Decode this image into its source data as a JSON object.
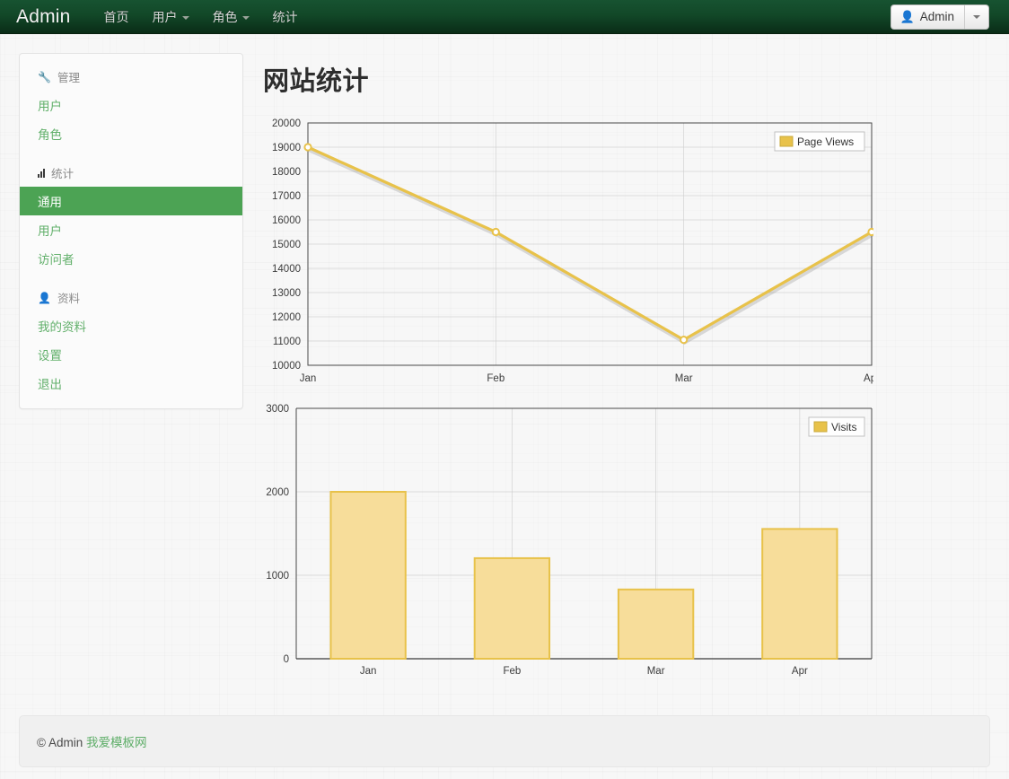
{
  "navbar": {
    "brand": "Admin",
    "items": [
      {
        "label": "首页",
        "has_caret": false
      },
      {
        "label": "用户",
        "has_caret": true
      },
      {
        "label": "角色",
        "has_caret": true
      },
      {
        "label": "统计",
        "has_caret": false
      }
    ],
    "user_button": {
      "label": "Admin",
      "icon": "user-icon"
    },
    "user_caret_icon": "chevron-down-icon"
  },
  "sidebar": {
    "groups": [
      {
        "header": "管理",
        "icon": "wrench-icon",
        "items": [
          {
            "label": "用户",
            "active": false
          },
          {
            "label": "角色",
            "active": false
          }
        ]
      },
      {
        "header": "统计",
        "icon": "bar-chart-icon",
        "items": [
          {
            "label": "通用",
            "active": true
          },
          {
            "label": "用户",
            "active": false
          },
          {
            "label": "访问者",
            "active": false
          }
        ]
      },
      {
        "header": "资料",
        "icon": "user-icon",
        "items": [
          {
            "label": "我的资料",
            "active": false
          },
          {
            "label": "设置",
            "active": false
          },
          {
            "label": "退出",
            "active": false
          }
        ]
      }
    ]
  },
  "main": {
    "page_title": "网站统计"
  },
  "footer": {
    "copyright": "© Admin",
    "link": "我爱模板网"
  },
  "colors": {
    "navbar_top": "#175331",
    "navbar_bottom": "#0a2c17",
    "sidebar_active": "#4ca354",
    "sidebar_link": "#62b06b",
    "series_stroke": "#e8c24a",
    "series_fill": "#f7dd9a",
    "grid": "#c9c9c9",
    "axis": "#444444"
  },
  "chart_data": [
    {
      "type": "line",
      "title": "",
      "legend": [
        "Page Views"
      ],
      "legend_position": "top-right",
      "categories": [
        "Jan",
        "Feb",
        "Mar",
        "Apr"
      ],
      "series": [
        {
          "name": "Page Views",
          "values": [
            19000,
            15500,
            11050,
            15500
          ]
        }
      ],
      "xlabel": "",
      "ylabel": "",
      "ylim": [
        10000,
        20000
      ],
      "yticks": [
        10000,
        11000,
        12000,
        13000,
        14000,
        15000,
        16000,
        17000,
        18000,
        19000,
        20000
      ],
      "grid": true,
      "markers": true
    },
    {
      "type": "bar",
      "title": "",
      "legend": [
        "Visits"
      ],
      "legend_position": "top-right",
      "categories": [
        "Jan",
        "Feb",
        "Mar",
        "Apr"
      ],
      "series": [
        {
          "name": "Visits",
          "values": [
            2000,
            1205,
            830,
            1555
          ]
        }
      ],
      "xlabel": "",
      "ylabel": "",
      "ylim": [
        0,
        3000
      ],
      "yticks": [
        0,
        1000,
        2000,
        3000
      ],
      "grid": true
    }
  ]
}
